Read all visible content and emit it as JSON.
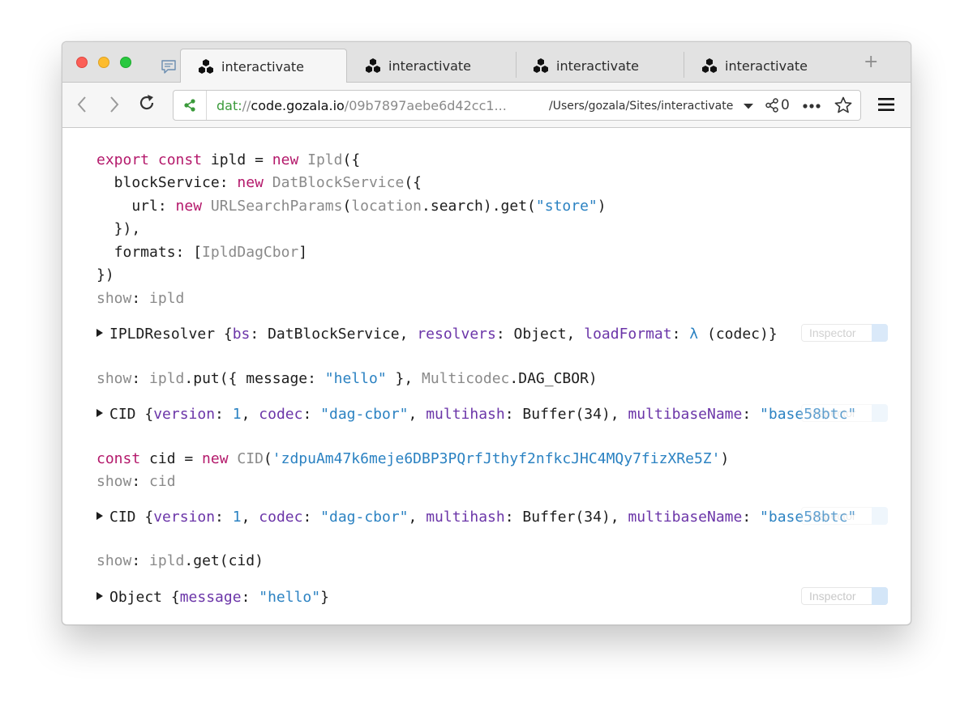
{
  "browser": {
    "tabs": [
      {
        "label": "interactivate",
        "icon": "hexagon-cluster-icon",
        "active": true
      },
      {
        "label": "interactivate",
        "icon": "hexagon-cluster-icon",
        "active": false
      },
      {
        "label": "interactivate",
        "icon": "hexagon-cluster-icon",
        "active": false
      },
      {
        "label": "interactivate",
        "icon": "hexagon-cluster-icon",
        "active": false
      }
    ],
    "new_tab_label": "+",
    "url": {
      "scheme": "dat:",
      "separator": "//",
      "host": "code.gozala.io",
      "path": "/09b7897aebe6d42cc1..."
    },
    "local_path": "/Users/gozala/Sites/interactivate",
    "peer_count": "0",
    "colors": {
      "accent_green": "#3a9a3a",
      "keyword": "#b4196b",
      "string": "#2b82c2",
      "property": "#6b35a8"
    }
  },
  "code": {
    "l1": {
      "t1": "export",
      "t2": " ",
      "t3": "const",
      "t4": " ipld = ",
      "t5": "new",
      "t6": " ",
      "t7": "Ipld",
      "t8": "({"
    },
    "l2": {
      "t1": "  blockService: ",
      "t2": "new",
      "t3": " ",
      "t4": "DatBlockService",
      "t5": "({"
    },
    "l3": {
      "t1": "    url: ",
      "t2": "new",
      "t3": " ",
      "t4": "URLSearchParams",
      "t5": "(",
      "t6": "location",
      "t7": ".search).get(",
      "t8": "\"store\"",
      "t9": ")"
    },
    "l4": {
      "t1": "  }),"
    },
    "l5": {
      "t1": "  formats: [",
      "t2": "IpldDagCbor",
      "t3": "]"
    },
    "l6": {
      "t1": "})"
    },
    "l7": {
      "t1": "show",
      "t2": ": ",
      "t3": "ipld"
    },
    "l8": {
      "t1": "show",
      "t2": ": ",
      "t3": "ipld",
      "t4": ".put({ message: ",
      "t5": "\"hello\"",
      "t6": " }, ",
      "t7": "Multicodec",
      "t8": ".DAG_CBOR)"
    },
    "l9": {
      "t1": "const",
      "t2": " cid = ",
      "t3": "new",
      "t4": " ",
      "t5": "CID",
      "t6": "(",
      "t7": "'zdpuAm47k6meje6DBP3PQrfJthyf2nfkcJHC4MQy7fizXRe5Z'",
      "t8": ")"
    },
    "l10": {
      "t1": "show",
      "t2": ": ",
      "t3": "cid"
    },
    "l11": {
      "t1": "show",
      "t2": ": ",
      "t3": "ipld",
      "t4": ".get(cid)"
    }
  },
  "outputs": {
    "o1": {
      "t1": "IPLDResolver {",
      "t2": "bs",
      "t3": ": DatBlockService, ",
      "t4": "resolvers",
      "t5": ": Object, ",
      "t6": "loadFormat",
      "t7": ": ",
      "t8": "λ",
      "t9": " (codec)}"
    },
    "o2": {
      "t1": "CID {",
      "t2": "version",
      "t3": ": ",
      "t4": "1",
      "t5": ", ",
      "t6": "codec",
      "t7": ": ",
      "t8": "\"dag-cbor\"",
      "t9": ", ",
      "t10": "multihash",
      "t11": ": Buffer(34), ",
      "t12": "multibaseName",
      "t13": ": ",
      "t14": "\"base58btc\""
    },
    "o3": {
      "t1": "CID {",
      "t2": "version",
      "t3": ": ",
      "t4": "1",
      "t5": ", ",
      "t6": "codec",
      "t7": ": ",
      "t8": "\"dag-cbor\"",
      "t9": ", ",
      "t10": "multihash",
      "t11": ": Buffer(34), ",
      "t12": "multibaseName",
      "t13": ": ",
      "t14": "\"base58btc\""
    },
    "o4": {
      "t1": "Object {",
      "t2": "message",
      "t3": ": ",
      "t4": "\"hello\"",
      "t5": "}"
    }
  },
  "inspector_label": "Inspector"
}
